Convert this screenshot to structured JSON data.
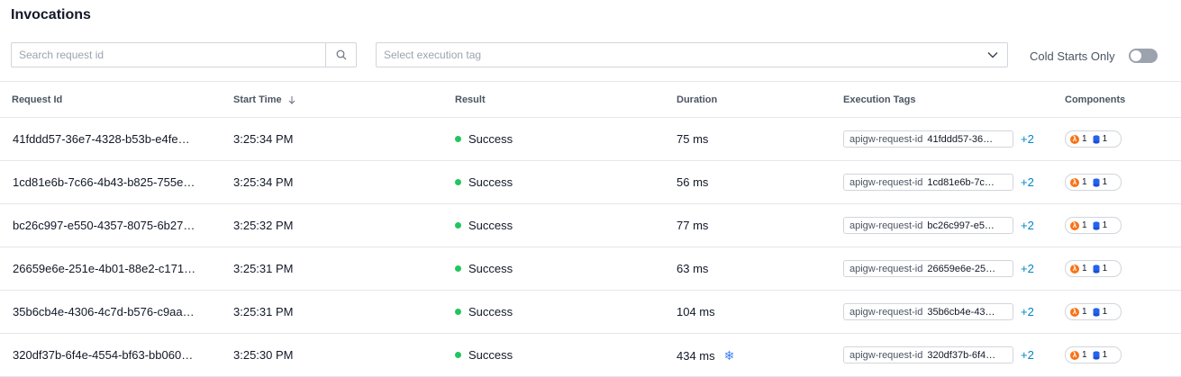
{
  "header": {
    "title": "Invocations"
  },
  "filters": {
    "search_placeholder": "Search request id",
    "tag_placeholder": "Select execution tag",
    "cold_starts_label": "Cold Starts Only",
    "cold_starts_on": false
  },
  "table": {
    "columns": [
      "Request Id",
      "Start Time",
      "Result",
      "Duration",
      "Execution Tags",
      "Components"
    ],
    "rows": [
      {
        "request_id": "41fddd57-36e7-4328-b53b-e4fe…",
        "start_time": "3:25:34 PM",
        "result": "Success",
        "duration": "75 ms",
        "cold": false,
        "tag_key": "apigw-request-id",
        "tag_value": "41fddd57-36…",
        "more": "+2",
        "lambda_count": "1",
        "db_count": "1"
      },
      {
        "request_id": "1cd81e6b-7c66-4b43-b825-755e…",
        "start_time": "3:25:34 PM",
        "result": "Success",
        "duration": "56 ms",
        "cold": false,
        "tag_key": "apigw-request-id",
        "tag_value": "1cd81e6b-7c…",
        "more": "+2",
        "lambda_count": "1",
        "db_count": "1"
      },
      {
        "request_id": "bc26c997-e550-4357-8075-6b27…",
        "start_time": "3:25:32 PM",
        "result": "Success",
        "duration": "77 ms",
        "cold": false,
        "tag_key": "apigw-request-id",
        "tag_value": "bc26c997-e5…",
        "more": "+2",
        "lambda_count": "1",
        "db_count": "1"
      },
      {
        "request_id": "26659e6e-251e-4b01-88e2-c171…",
        "start_time": "3:25:31 PM",
        "result": "Success",
        "duration": "63 ms",
        "cold": false,
        "tag_key": "apigw-request-id",
        "tag_value": "26659e6e-25…",
        "more": "+2",
        "lambda_count": "1",
        "db_count": "1"
      },
      {
        "request_id": "35b6cb4e-4306-4c7d-b576-c9aa…",
        "start_time": "3:25:31 PM",
        "result": "Success",
        "duration": "104 ms",
        "cold": false,
        "tag_key": "apigw-request-id",
        "tag_value": "35b6cb4e-43…",
        "more": "+2",
        "lambda_count": "1",
        "db_count": "1"
      },
      {
        "request_id": "320df37b-6f4e-4554-bf63-bb060…",
        "start_time": "3:25:30 PM",
        "result": "Success",
        "duration": "434 ms",
        "cold": true,
        "tag_key": "apigw-request-id",
        "tag_value": "320df37b-6f4…",
        "more": "+2",
        "lambda_count": "1",
        "db_count": "1"
      }
    ]
  },
  "icons": {
    "search": "search-icon",
    "dropdown": "chevron-down-icon",
    "sort": "arrow-down-icon",
    "cold": "snowflake-icon",
    "lambda": "lambda-icon",
    "db": "database-icon"
  },
  "colors": {
    "success": "#22c55e",
    "link": "#0284c7",
    "lambda": "#f97316",
    "db": "#2563eb"
  }
}
